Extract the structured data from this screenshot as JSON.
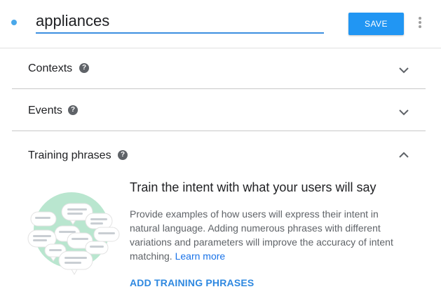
{
  "header": {
    "intent_name": "appliances",
    "save_label": "SAVE"
  },
  "sections": [
    {
      "title": "Contexts",
      "help_icon": "help-circle-icon",
      "chevron": "chevron-down-icon"
    },
    {
      "title": "Events",
      "help_icon": "help-circle-icon",
      "chevron": "chevron-down-icon"
    },
    {
      "title": "Training phrases",
      "help_icon": "help-circle-icon",
      "chevron": "chevron-up-icon"
    }
  ],
  "training": {
    "heading": "Train the intent with what your users will say",
    "description": "Provide examples of how users will express their intent in natural language. Adding numerous phrases with different variations and parameters will improve the accuracy of intent matching.",
    "learn_more": "Learn more",
    "add_label": "ADD TRAINING PHRASES",
    "illustration": "chat-bubbles-illustration"
  },
  "colors": {
    "accent": "#2196f3",
    "link": "#1a73e8",
    "input_underline": "#3d8fe0",
    "illustration_green": "#b9e6cf"
  }
}
